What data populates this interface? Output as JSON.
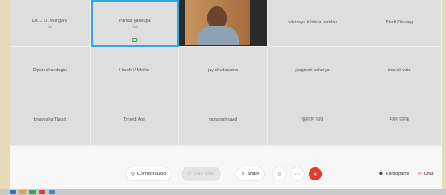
{
  "participants": [
    {
      "name": "Dr. J. D. Mungara",
      "sub": "Me"
    },
    {
      "name": "Pankaj yadvupa",
      "sub": "Host",
      "active": true
    },
    {
      "name": "",
      "video": true
    },
    {
      "name": "bakravya krishna haridas"
    },
    {
      "name": "Bhatt Devang"
    },
    {
      "name": "Dipen chavdagor"
    },
    {
      "name": "Harsh V Mehta"
    },
    {
      "name": "jay chudasama"
    },
    {
      "name": "jaegresh acharya"
    },
    {
      "name": "manali vala"
    },
    {
      "name": "bhavesha Tiwari"
    },
    {
      "name": "Trivedi Anil"
    },
    {
      "name": "yamannimaval"
    },
    {
      "name": "कुलदीप जाव"
    },
    {
      "name": "महेश प्रतिक"
    }
  ],
  "toolbar": {
    "connect_audio": "Connect audio",
    "start_video": "Start video",
    "share": "Share",
    "participants": "Participants",
    "chat": "Chat"
  },
  "icons": {
    "reactions": "smiley-icon",
    "more": "more-icon",
    "end": "close-icon"
  },
  "colors": {
    "active_border": "#2fa8de",
    "end_button": "#e23b2e"
  }
}
